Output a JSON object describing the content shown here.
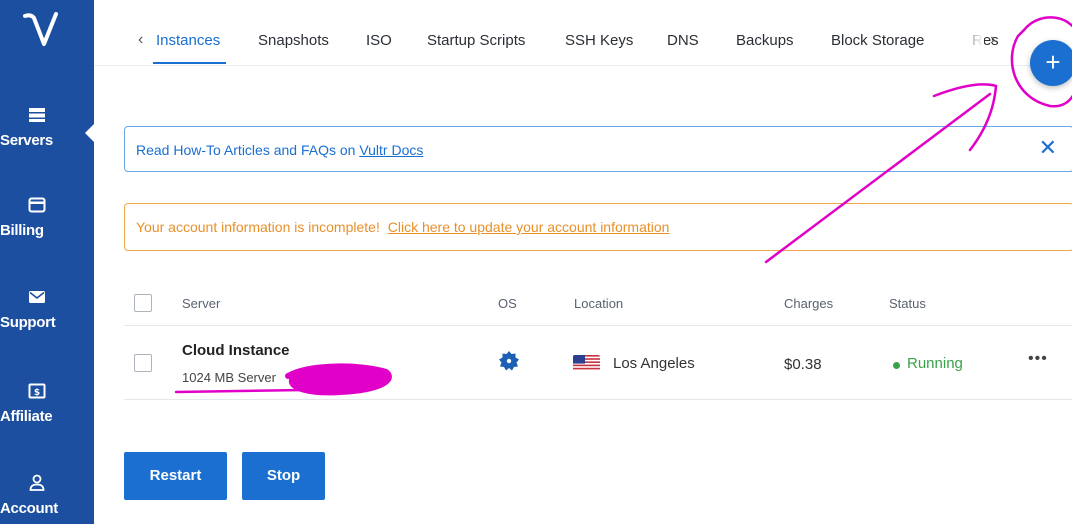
{
  "sidebar": {
    "items": [
      {
        "label": "Servers",
        "icon": "servers-icon",
        "active": true
      },
      {
        "label": "Billing",
        "icon": "credit-card-icon"
      },
      {
        "label": "Support",
        "icon": "envelope-icon"
      },
      {
        "label": "Affiliate",
        "icon": "dollar-icon"
      },
      {
        "label": "Account",
        "icon": "user-icon"
      }
    ]
  },
  "tabs": {
    "items": [
      "Instances",
      "Snapshots",
      "ISO",
      "Startup Scripts",
      "SSH Keys",
      "DNS",
      "Backups",
      "Block Storage",
      "Res"
    ],
    "active": "Instances"
  },
  "add_button": {
    "label": "+"
  },
  "info_banner": {
    "text": "Read How-To Articles and FAQs on ",
    "link": "Vultr Docs",
    "close": "✕"
  },
  "warn_banner": {
    "text": "Your account information is incomplete!",
    "link": "Click here to update your account information"
  },
  "table": {
    "headers": {
      "server": "Server",
      "os": "OS",
      "location": "Location",
      "charges": "Charges",
      "status": "Status"
    },
    "rows": [
      {
        "name": "Cloud Instance",
        "sub": "1024 MB Server",
        "location": "Los Angeles",
        "charges": "$0.38",
        "status": "Running",
        "menu": "•••"
      }
    ]
  },
  "actions": {
    "restart": "Restart",
    "stop": "Stop"
  },
  "colors": {
    "primary": "#1a6fd1",
    "sidebar": "#1d4fa0",
    "warning": "#e8902a",
    "success": "#3aa24a",
    "annotation": "#e000c8"
  }
}
